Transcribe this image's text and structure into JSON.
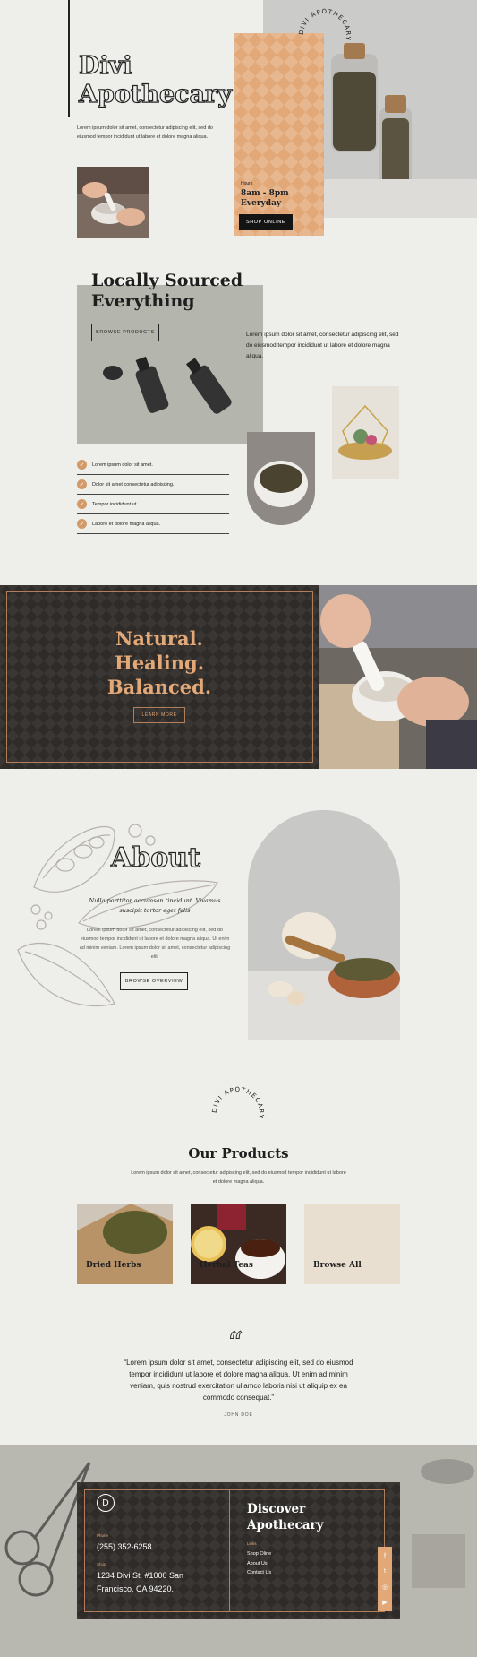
{
  "hero": {
    "title_line1": "Divi",
    "title_line2": "Apothecary",
    "text": "Lorem ipsum dolor sit amet, consectetur adipiscing elit, sed do eiusmod tempor incididunt ut labore et dolore magna aliqua.",
    "hours_label": "Hours",
    "hours_value": "8am - 8pm",
    "hours_days": "Everyday",
    "shop_button": "SHOP ONLINE",
    "badge_text": "DIVI APOTHECARY"
  },
  "sourced": {
    "title": "Locally Sourced Everything",
    "browse_button": "BROWSE PRODUCTS",
    "text": "Lorem ipsum dolor sit amet, consectetur adipiscing elit, sed do eiusmod tempor incididunt ut labore et dolore magna aliqua.",
    "checklist": [
      "Lorem ipsum dolor sit amet.",
      "Dolor sit amet consectetur adipiscing.",
      "Tempor incididunt ut.",
      "Labore et dolore magna aliqua."
    ]
  },
  "banner": {
    "line1": "Natural.",
    "line2": "Healing.",
    "line3": "Balanced.",
    "button": "LEARN MORE"
  },
  "about": {
    "title": "About",
    "subtitle": "Nulla porttitor accumsan tincidunt. Vivamus suscipit tortor eget felis",
    "text": "Lorem ipsum dolor sit amet, consectetur adipiscing elit, sed do eiusmod tempor incididunt ut labore et dolore magna aliqua. Ut enim ad minim veniam. Lorem ipsum dolor sit amet, consectetur adipiscing elit.",
    "button": "BROWSE OVERVIEW"
  },
  "products": {
    "badge_text": "DIVI APOTHECARY",
    "title": "Our Products",
    "text": "Lorem ipsum dolor sit amet, consectetur adipiscing elit, sed do eiusmod tempor incididunt ut labore et dolore magna aliqua.",
    "cards": [
      "Dried Herbs",
      "Herbal Teas",
      "Browse All"
    ]
  },
  "testimonial": {
    "quote": "“Lorem ipsum dolor sit amet, consectetur adipiscing elit, sed do eiusmod tempor incididunt ut labore et dolore magna aliqua. Ut enim ad minim veniam, quis nostrud exercitation ullamco laboris nisi ut aliquip ex ea commodo consequat.”",
    "author": "JOHN DOE"
  },
  "footer": {
    "logo_letter": "D",
    "phone_label": "Phone",
    "phone": "(255) 352-6258",
    "shop_label": "Shop",
    "address_line1": "1234 Divi St. #1000 San",
    "address_line2": "Francisco, CA 94220.",
    "title_line1": "Discover",
    "title_line2": "Apothecary",
    "links_label": "Links",
    "links": [
      "Shop Oline",
      "About Us",
      "Contact Us"
    ],
    "social_icons": [
      "facebook-icon",
      "twitter-icon",
      "instagram-icon",
      "youtube-icon"
    ]
  },
  "colors": {
    "background": "#eeeeea",
    "accent": "#e2a878",
    "dark": "#2e2b29",
    "text": "#1e1e1e"
  }
}
